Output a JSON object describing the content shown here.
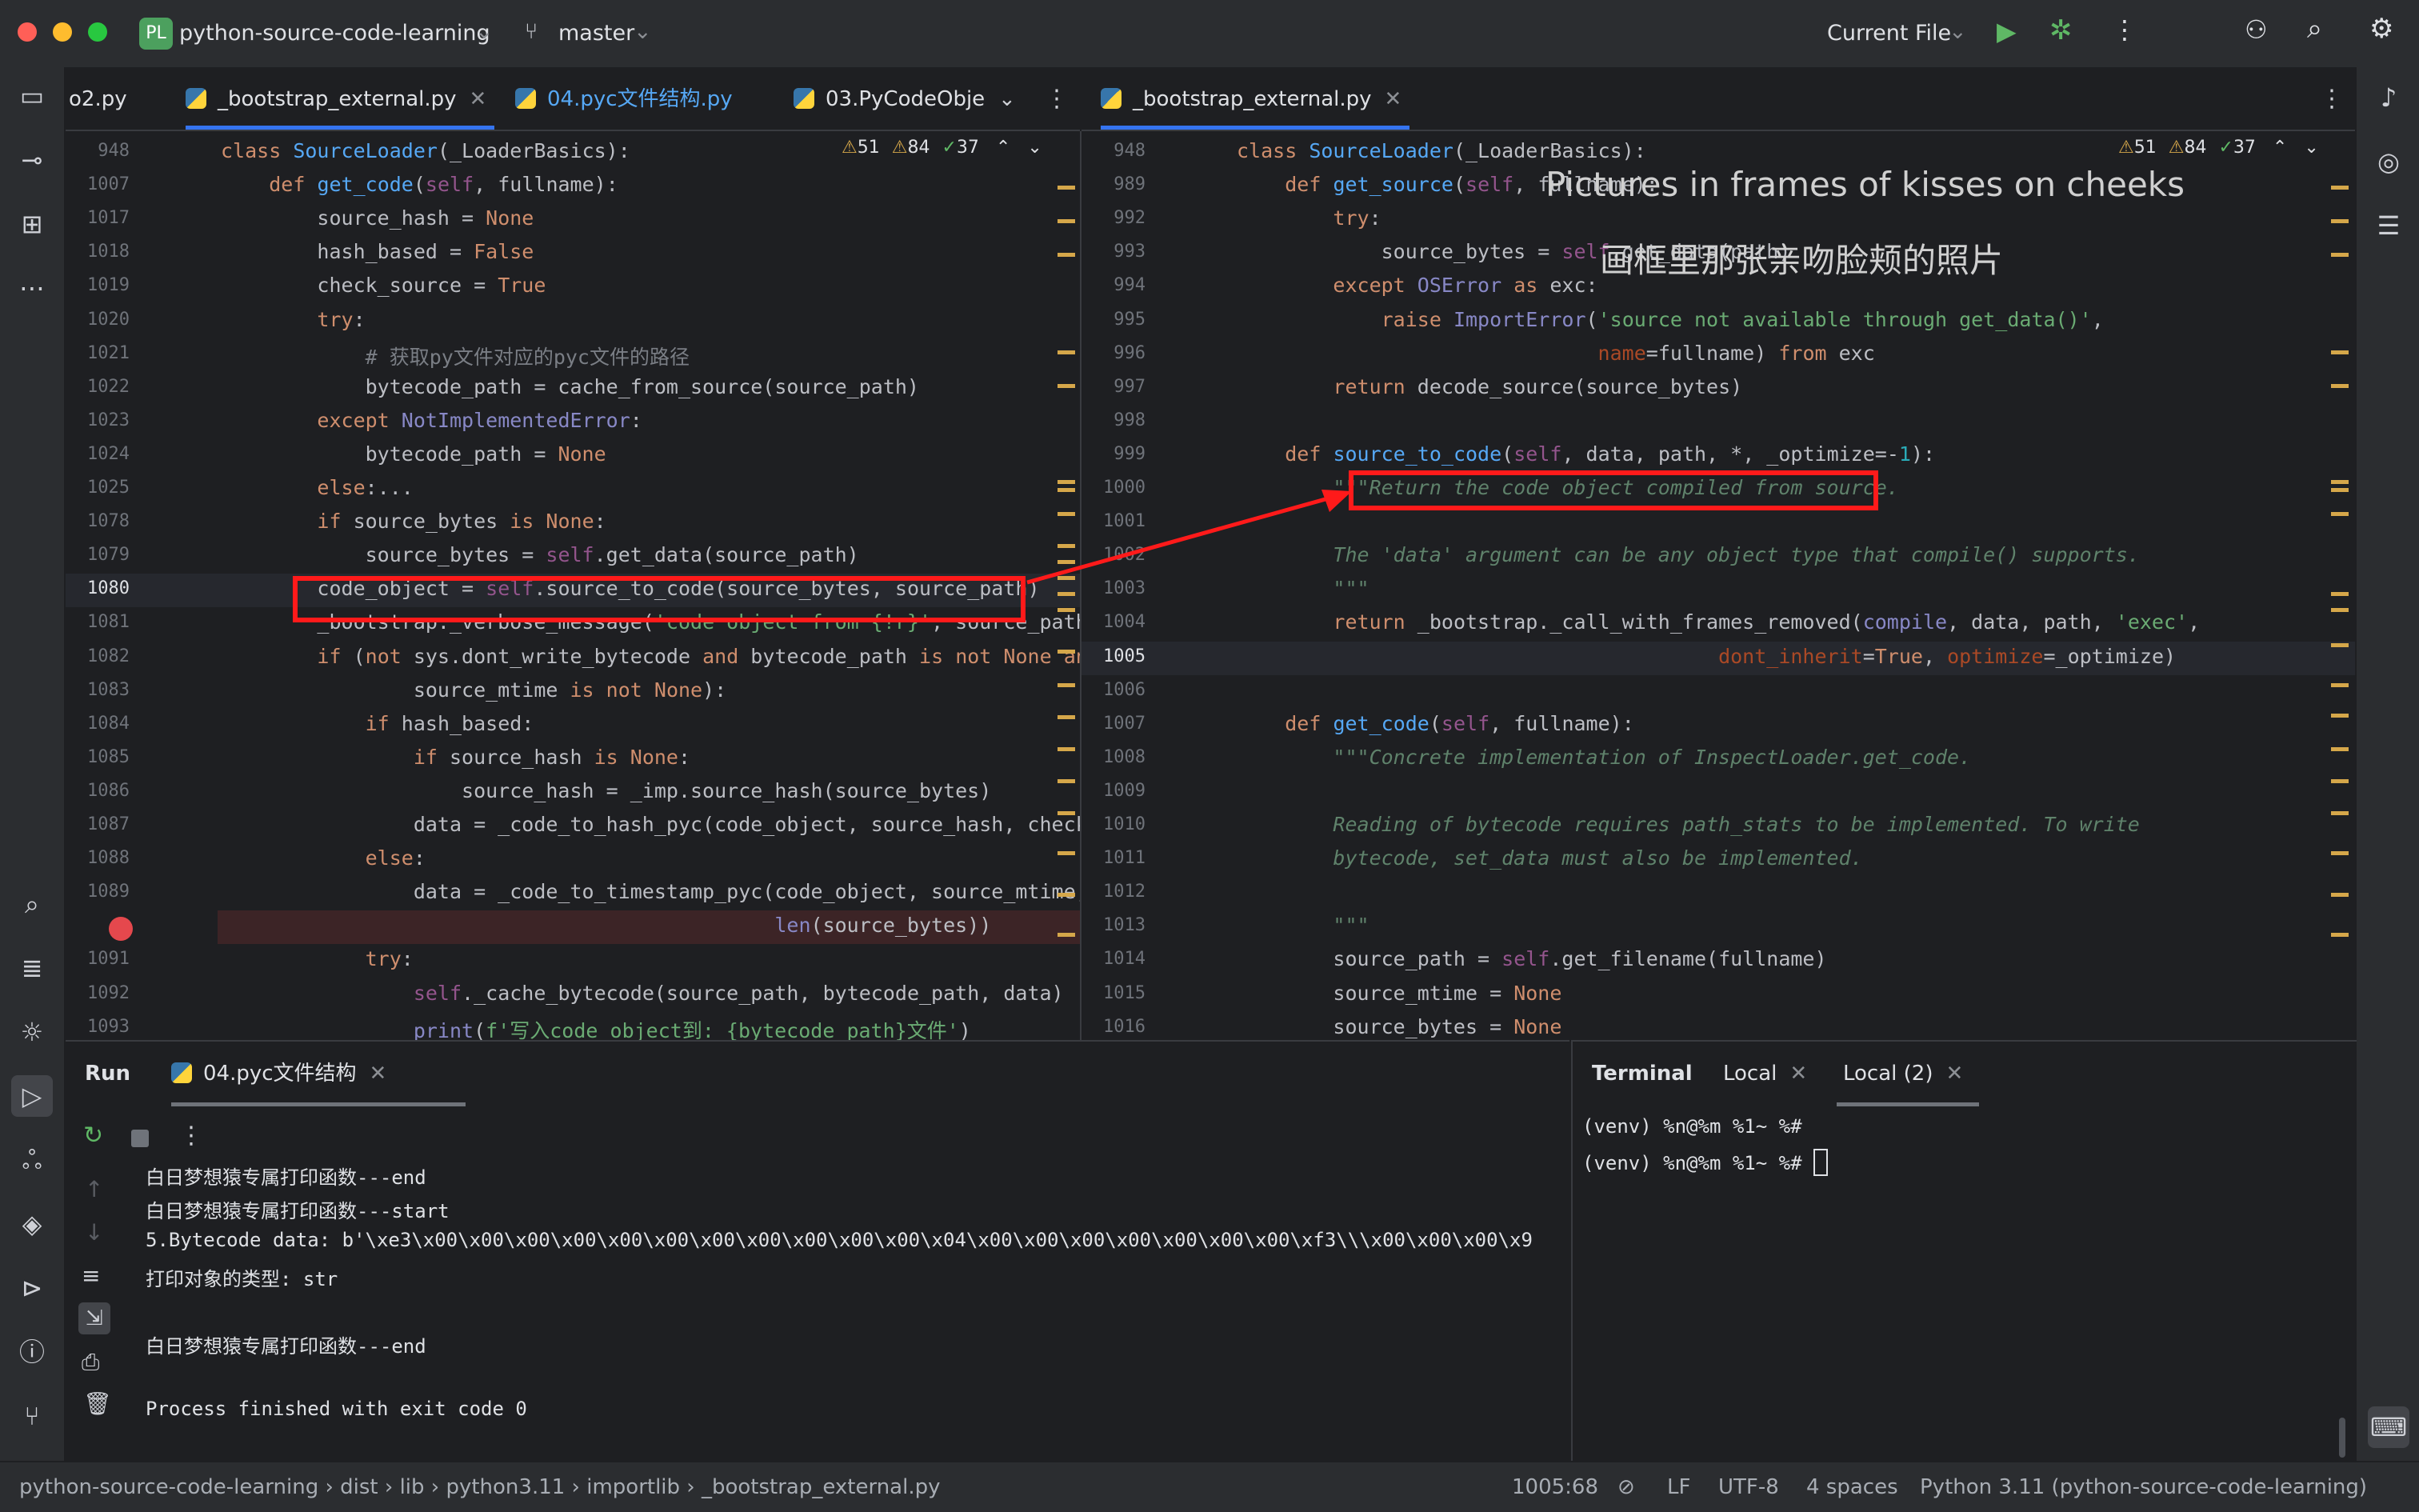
{
  "titlebar": {
    "project_badge": "PL",
    "project_name": "python-source-code-learning",
    "branch": "master",
    "run_config": "Current File"
  },
  "left_editor": {
    "tabs": [
      {
        "label": "o2.py"
      },
      {
        "label": "_bootstrap_external.py",
        "active": true
      },
      {
        "label": "04.pyc文件结构.py"
      },
      {
        "label": "03.PyCodeObje"
      }
    ],
    "inspections": {
      "warnings": "51",
      "weak": "84",
      "ok": "37"
    },
    "lines": [
      {
        "num": "948",
        "code": "class SourceLoader(_LoaderBasics):"
      },
      {
        "num": "1007",
        "code": "    def get_code(self, fullname):"
      },
      {
        "num": "1017",
        "code": "        source_hash = None"
      },
      {
        "num": "1018",
        "code": "        hash_based = False"
      },
      {
        "num": "1019",
        "code": "        check_source = True"
      },
      {
        "num": "1020",
        "code": "        try:"
      },
      {
        "num": "1021",
        "code": "            # 获取py文件对应的pyc文件的路径"
      },
      {
        "num": "1022",
        "code": "            bytecode_path = cache_from_source(source_path)"
      },
      {
        "num": "1023",
        "code": "        except NotImplementedError:"
      },
      {
        "num": "1024",
        "code": "            bytecode_path = None"
      },
      {
        "num": "1025",
        "code": "        else:..."
      },
      {
        "num": "1078",
        "code": "        if source_bytes is None:"
      },
      {
        "num": "1079",
        "code": "            source_bytes = self.get_data(source_path)"
      },
      {
        "num": "1080",
        "code": "        code_object = self.source_to_code(source_bytes, source_path)"
      },
      {
        "num": "1081",
        "code": "        _bootstrap._verbose_message('code object from {!r}', source_path)"
      },
      {
        "num": "1082",
        "code": "        if (not sys.dont_write_bytecode and bytecode_path is not None and"
      },
      {
        "num": "1083",
        "code": "                source_mtime is not None):"
      },
      {
        "num": "1084",
        "code": "            if hash_based:"
      },
      {
        "num": "1085",
        "code": "                if source_hash is None:"
      },
      {
        "num": "1086",
        "code": "                    source_hash = _imp.source_hash(source_bytes)"
      },
      {
        "num": "1087",
        "code": "                data = _code_to_hash_pyc(code_object, source_hash, check_so"
      },
      {
        "num": "1088",
        "code": "            else:"
      },
      {
        "num": "1089",
        "code": "                data = _code_to_timestamp_pyc(code_object, source_mtime,"
      },
      {
        "num": "",
        "code": "                                              len(source_bytes))"
      },
      {
        "num": "1091",
        "code": "            try:"
      },
      {
        "num": "1092",
        "code": "                self._cache_bytecode(source_path, bytecode_path, data)"
      },
      {
        "num": "1093",
        "code": "                print(f'写入code object到: {bytecode_path}文件')"
      }
    ]
  },
  "right_editor": {
    "tabs": [
      {
        "label": "_bootstrap_external.py",
        "active": true
      }
    ],
    "inspections": {
      "warnings": "51",
      "weak": "84",
      "ok": "37"
    },
    "lines": [
      {
        "num": "948",
        "code": "class SourceLoader(_LoaderBasics):"
      },
      {
        "num": "989",
        "code": "    def get_source(self, fullname):"
      },
      {
        "num": "992",
        "code": "        try:"
      },
      {
        "num": "993",
        "code": "            source_bytes = self.get_data(path)"
      },
      {
        "num": "994",
        "code": "        except OSError as exc:"
      },
      {
        "num": "995",
        "code": "            raise ImportError('source not available through get_data()',"
      },
      {
        "num": "996",
        "code": "                              name=fullname) from exc"
      },
      {
        "num": "997",
        "code": "        return decode_source(source_bytes)"
      },
      {
        "num": "998",
        "code": ""
      },
      {
        "num": "999",
        "code": "    def source_to_code(self, data, path, *, _optimize=-1):"
      },
      {
        "num": "1000",
        "code": "        \"\"\"Return the code object compiled from source."
      },
      {
        "num": "1001",
        "code": ""
      },
      {
        "num": "1002",
        "code": "        The 'data' argument can be any object type that compile() supports."
      },
      {
        "num": "1003",
        "code": "        \"\"\""
      },
      {
        "num": "1004",
        "code": "        return _bootstrap._call_with_frames_removed(compile, data, path, 'exec',"
      },
      {
        "num": "1005",
        "code": "                                        dont_inherit=True, optimize=_optimize)"
      },
      {
        "num": "1006",
        "code": ""
      },
      {
        "num": "1007",
        "code": "    def get_code(self, fullname):"
      },
      {
        "num": "1008",
        "code": "        \"\"\"Concrete implementation of InspectLoader.get_code."
      },
      {
        "num": "1009",
        "code": ""
      },
      {
        "num": "1010",
        "code": "        Reading of bytecode requires path_stats to be implemented. To write"
      },
      {
        "num": "1011",
        "code": "        bytecode, set_data must also be implemented."
      },
      {
        "num": "1012",
        "code": ""
      },
      {
        "num": "1013",
        "code": "        \"\"\""
      },
      {
        "num": "1014",
        "code": "        source_path = self.get_filename(fullname)"
      },
      {
        "num": "1015",
        "code": "        source_mtime = None"
      },
      {
        "num": "1016",
        "code": "        source_bytes = None"
      }
    ]
  },
  "overlay": {
    "line1": "Pictures in frames of kisses on cheeks",
    "line2": "画框里那张亲吻脸颊的照片"
  },
  "run_panel": {
    "title": "Run",
    "tab": "04.pyc文件结构",
    "output": [
      "白日梦想猿专属打印函数---end",
      "白日梦想猿专属打印函数---start",
      "5.Bytecode data: b'\\xe3\\x00\\x00\\x00\\x00\\x00\\x00\\x00\\x00\\x00\\x00\\x00\\x04\\x00\\x00\\x00\\x00\\x00\\x00\\x00\\xf3\\\\\\x00\\x00\\x00\\x9",
      "打印对象的类型: str",
      "",
      "白日梦想猿专属打印函数---end",
      "",
      "Process finished with exit code 0"
    ]
  },
  "terminal": {
    "title": "Terminal",
    "tabs": [
      "Local",
      "Local (2)"
    ],
    "lines": [
      "(venv) %n@%m %1~ %#",
      "(venv) %n@%m %1~ %#"
    ]
  },
  "statusbar": {
    "breadcrumbs": [
      "python-source-code-learning",
      "dist",
      "lib",
      "python3.11",
      "importlib",
      "_bootstrap_external.py"
    ],
    "position": "1005:68",
    "line_sep": "LF",
    "encoding": "UTF-8",
    "indent": "4 spaces",
    "interpreter": "Python 3.11 (python-source-code-learning)"
  },
  "colors": {
    "accent": "#3574f0",
    "annotation": "#ff1a1a",
    "keyword": "#cf8e6d",
    "function": "#56a8f5",
    "string": "#6aab73"
  }
}
